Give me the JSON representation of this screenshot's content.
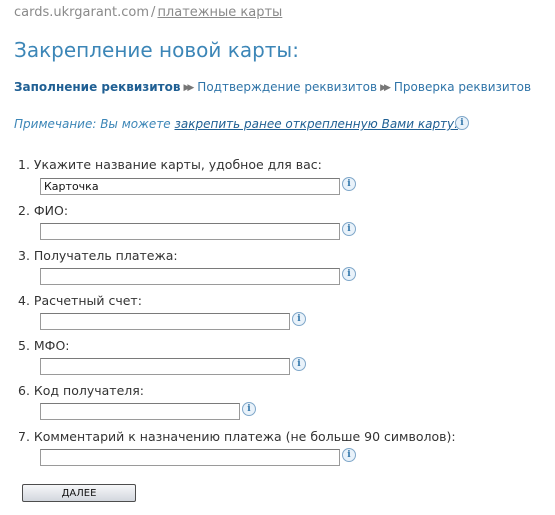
{
  "breadcrumb": {
    "site": "cards.ukrgarant.com",
    "separator": "/",
    "section": "платежные карты"
  },
  "page_title": "Закрепление новой карты:",
  "steps": [
    {
      "label": "Заполнение реквизитов",
      "active": true
    },
    {
      "label": "Подтверждение реквизитов",
      "active": false
    },
    {
      "label": "Проверка реквизитов",
      "active": false
    }
  ],
  "note": {
    "prefix": "Примечание: Вы можете ",
    "link": "закрепить ранее открепленную Вами карту."
  },
  "icons": {
    "info": "info-icon",
    "step_arrow": "double-right-arrow-icon"
  },
  "form": {
    "fields": [
      {
        "label": "1. Укажите название карты, удобное для вас:",
        "value": "Карточка"
      },
      {
        "label": "2. ФИО:",
        "value": ""
      },
      {
        "label": "3. Получатель платежа:",
        "value": ""
      },
      {
        "label": "4. Расчетный счет:",
        "value": ""
      },
      {
        "label": "5. МФО:",
        "value": ""
      },
      {
        "label": "6. Код получателя:",
        "value": ""
      },
      {
        "label": "7. Комментарий к назначению платежа (не больше 90 символов):",
        "value": ""
      }
    ],
    "next_label": "ДАЛЕЕ"
  },
  "colors": {
    "title": "#3c86b7",
    "link": "#1f5f93",
    "text": "#333333",
    "breadcrumb": "#8a8a8a"
  }
}
